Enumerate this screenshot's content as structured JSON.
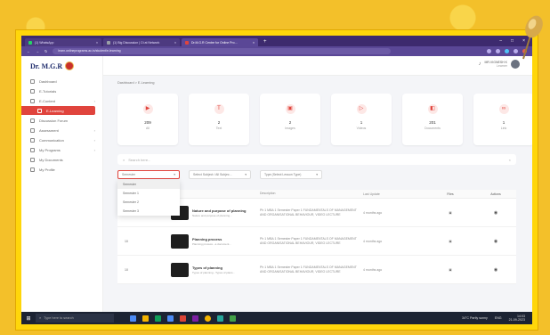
{
  "tabs": [
    {
      "label": "(1) WhatsApp",
      "color": "#25d366"
    },
    {
      "label": "(1) Big Discussion | Ct at Network",
      "color": "#9aa0a6"
    },
    {
      "label": "Dr.M.G.R Centre for Online Pro...",
      "color": "#e0443d",
      "active": true
    }
  ],
  "address": {
    "url": "learn.onlineprograms.ac.in/student/e-learning"
  },
  "brand": {
    "name": "Dr. M.G.R"
  },
  "user": {
    "name": "MR.VIGNESH K",
    "role": "Learner"
  },
  "sidebar": {
    "items": [
      {
        "label": "Dashboard",
        "has_chevron": false,
        "active": false
      },
      {
        "label": "E-Tutorials",
        "has_chevron": false,
        "active": false
      },
      {
        "label": "E-Content",
        "has_chevron": true,
        "active": false
      },
      {
        "label": "E-Learning",
        "has_chevron": false,
        "active": true
      },
      {
        "label": "Discussion Forum",
        "has_chevron": false,
        "active": false
      },
      {
        "label": "Assessment",
        "has_chevron": true,
        "active": false
      },
      {
        "label": "Communication",
        "has_chevron": true,
        "active": false
      },
      {
        "label": "My Programs",
        "has_chevron": true,
        "active": false
      },
      {
        "label": "My Documents",
        "has_chevron": false,
        "active": false
      },
      {
        "label": "My Profile",
        "has_chevron": false,
        "active": false
      }
    ]
  },
  "breadcrumb": "Dashboard > E-Learning",
  "stats": [
    {
      "value": "209",
      "label": "All",
      "icon": "play-icon"
    },
    {
      "value": "2",
      "label": "Text",
      "icon": "text-icon"
    },
    {
      "value": "2",
      "label": "Images",
      "icon": "image-icon"
    },
    {
      "value": "1",
      "label": "Videos",
      "icon": "video-icon"
    },
    {
      "value": "201",
      "label": "Documents",
      "icon": "document-icon"
    },
    {
      "value": "1",
      "label": "Link",
      "icon": "link-icon"
    }
  ],
  "search": {
    "placeholder": "Search here..."
  },
  "filters": [
    {
      "value": "Semester"
    },
    {
      "value": "Select Subject / All Subjec..."
    },
    {
      "value": "Type (Select Lesson Type)"
    }
  ],
  "dropdown": {
    "options": [
      "Semester",
      "Semester 1",
      "Semester 2",
      "Semester 3"
    ]
  },
  "table": {
    "headers": [
      "",
      "Topic",
      "Description",
      "Last Update",
      "Files",
      "Actions"
    ],
    "rows": [
      {
        "num": "",
        "title": "Nature and purpose of planning",
        "subtitle": "Nature and purpose of planning...",
        "desc": "Ph 1 MBA 1 Semester Paper 1 FUNDAMENTALS OF MANAGEMENT AND ORGANISATIONAL BEHAVIOUR, VIDEO LECTURE",
        "updated": "4 months ago",
        "files": "▣",
        "action": "◉"
      },
      {
        "num": "10",
        "title": "Planning process",
        "subtitle": "Planning process - a document...",
        "desc": "Ph 1 MBA 1 Semester Paper 1 FUNDAMENTALS OF MANAGEMENT AND ORGANISATIONAL BEHAVIOUR, VIDEO LECTURE",
        "updated": "4 months ago",
        "files": "▣",
        "action": "◉"
      },
      {
        "num": "10",
        "title": "Types of planning",
        "subtitle": "Types of planning - Types of plans...",
        "desc": "Ph 1 MBA 1 Semester Paper 1 FUNDAMENTALS OF MANAGEMENT AND ORGANISATIONAL BEHAVIOUR, VIDEO LECTURE",
        "updated": "4 months ago",
        "files": "▣",
        "action": "◉"
      }
    ]
  },
  "taskbar": {
    "search_placeholder": "Type here to search",
    "weather": "34°C Partly sunny",
    "lang": "ENG",
    "time": "14:03",
    "date": "21-09-2023"
  }
}
